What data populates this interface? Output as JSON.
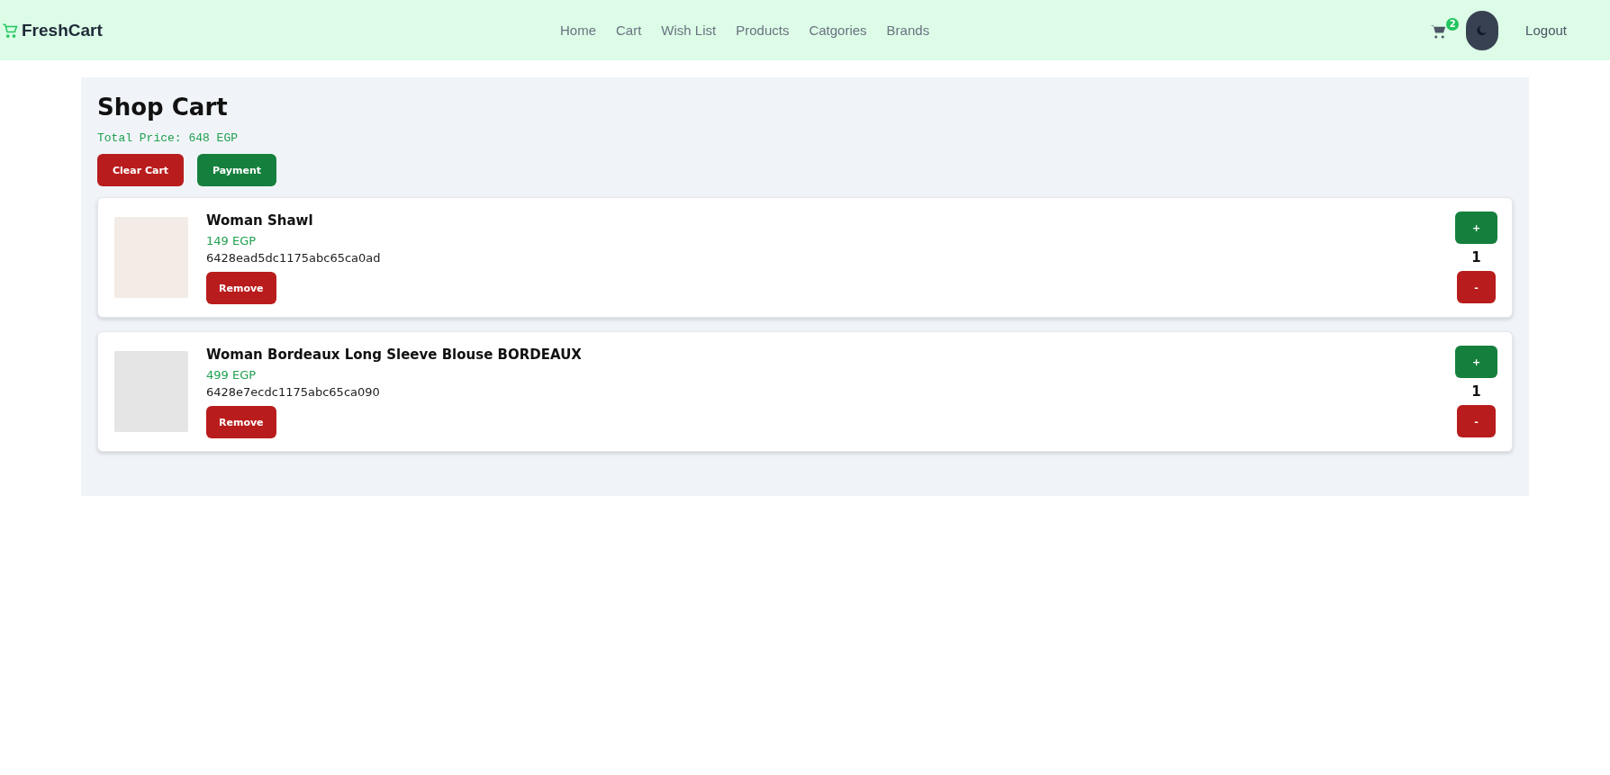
{
  "navbar": {
    "logo": "FreshCart",
    "links": [
      "Home",
      "Cart",
      "Wish List",
      "Products",
      "Catgories",
      "Brands"
    ],
    "cart_badge": "2",
    "logout": "Logout"
  },
  "cart": {
    "title": "Shop Cart",
    "total": "Total Price: 648 EGP",
    "clear_button": "Clear Cart",
    "payment_button": "Payment",
    "items": [
      {
        "name": "Woman Shawl",
        "price": "149 EGP",
        "id": "6428ead5dc1175abc65ca0ad",
        "remove": "Remove",
        "plus": "+",
        "count": "1",
        "minus": "-"
      },
      {
        "name": "Woman Bordeaux Long Sleeve Blouse BORDEAUX",
        "price": "499 EGP",
        "id": "6428e7ecdc1175abc65ca090",
        "remove": "Remove",
        "plus": "+",
        "count": "1",
        "minus": "-"
      }
    ]
  }
}
